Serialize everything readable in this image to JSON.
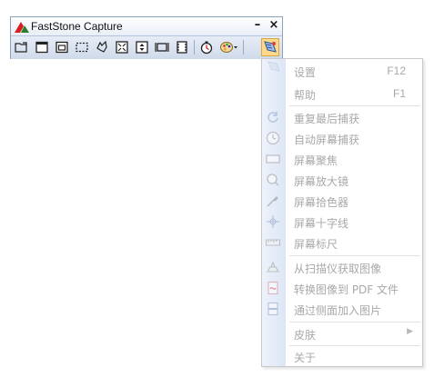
{
  "window": {
    "title": "FastStone Capture",
    "minimize_glyph": "–",
    "close_glyph": "×"
  },
  "toolbar": {
    "buttons": [
      {
        "name": "open-file-icon"
      },
      {
        "name": "capture-window-icon"
      },
      {
        "name": "capture-object-icon"
      },
      {
        "name": "capture-rectangle-icon"
      },
      {
        "name": "capture-freehand-icon"
      },
      {
        "name": "capture-fullscreen-icon"
      },
      {
        "name": "capture-scrolling-icon"
      },
      {
        "name": "capture-fixed-region-icon"
      },
      {
        "name": "video-recorder-icon"
      },
      {
        "name": "delay-timer-icon"
      },
      {
        "name": "color-palette-icon"
      },
      {
        "name": "settings-menu-icon"
      }
    ]
  },
  "menu": {
    "items": [
      {
        "label": "设置",
        "shortcut": "F12",
        "icon": "settings-icon"
      },
      {
        "label": "帮助",
        "shortcut": "F1",
        "icon": "help-icon"
      },
      {
        "label": "重复最后捕获",
        "icon": "repeat-icon"
      },
      {
        "label": "自动屏幕捕获",
        "icon": "clock-icon"
      },
      {
        "label": "屏幕聚焦",
        "icon": "focus-rectangle-icon"
      },
      {
        "label": "屏幕放大镜",
        "icon": "magnifier-icon"
      },
      {
        "label": "屏幕拾色器",
        "icon": "color-picker-icon"
      },
      {
        "label": "屏幕十字线",
        "icon": "crosshair-icon"
      },
      {
        "label": "屏幕标尺",
        "icon": "ruler-icon"
      },
      {
        "label": "从扫描仪获取图像",
        "icon": "scanner-icon"
      },
      {
        "label": "转换图像到 PDF 文件",
        "icon": "pdf-icon"
      },
      {
        "label": "通过侧面加入图片",
        "icon": "join-images-icon"
      },
      {
        "label": "皮肤",
        "icon": "skin-icon"
      },
      {
        "label": "关于",
        "icon": "about-icon"
      }
    ]
  },
  "colors": {
    "menu_text_disabled": "#a8a8a8",
    "toolbar_bg": "#cfdaea",
    "active_button": "#ffd98a"
  }
}
